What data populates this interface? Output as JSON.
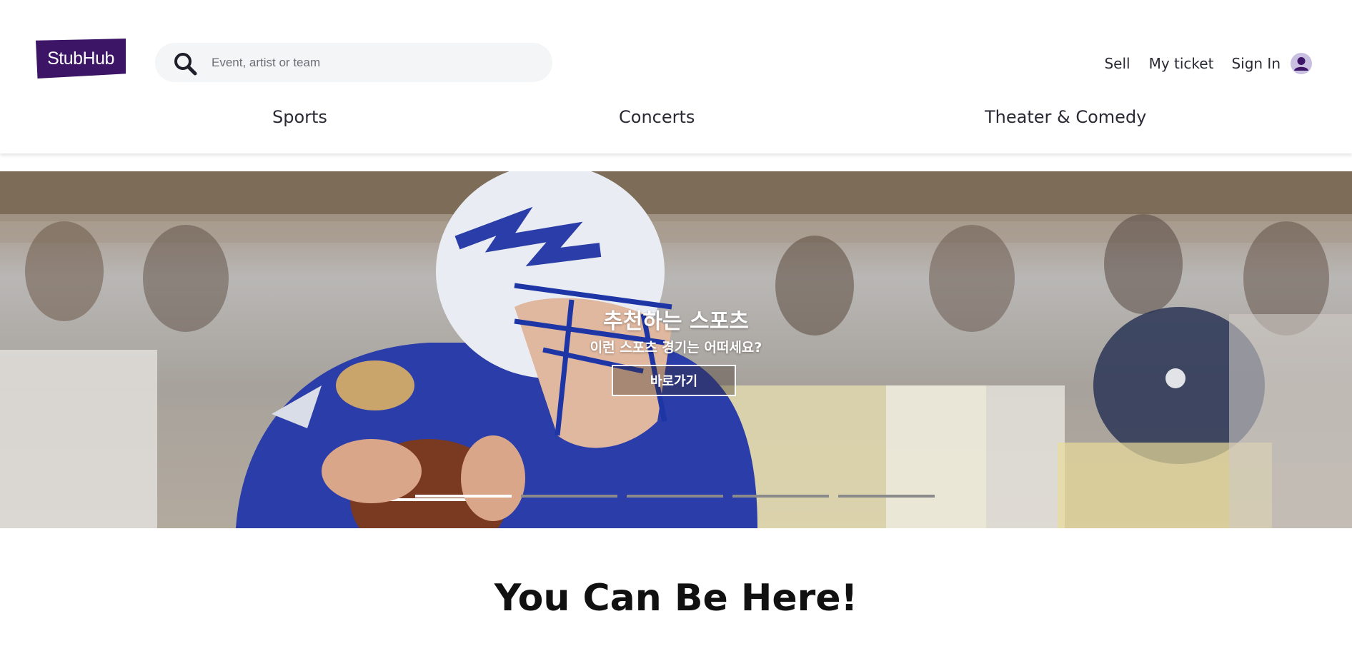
{
  "brand": {
    "logo_text": "StubHub",
    "color": "#3c1566"
  },
  "search": {
    "placeholder": "Event, artist or team",
    "value": ""
  },
  "topnav": {
    "sell": "Sell",
    "my_ticket": "My ticket",
    "sign_in": "Sign In"
  },
  "categories": [
    {
      "label": "Sports"
    },
    {
      "label": "Concerts"
    },
    {
      "label": "Theater & Comedy"
    }
  ],
  "hero": {
    "title": "추천하는 스포츠",
    "subtitle": "이런 스포츠 경기는 어떠세요?",
    "button_label": "바로가기",
    "slides": 5,
    "active_slide": 1
  },
  "section": {
    "title": "You Can Be Here!"
  },
  "icons": {
    "search": "search-icon",
    "user": "user-icon"
  },
  "colors": {
    "accent": "#3c1566",
    "text": "#2a2a35",
    "search_bg": "#f4f5f6"
  }
}
